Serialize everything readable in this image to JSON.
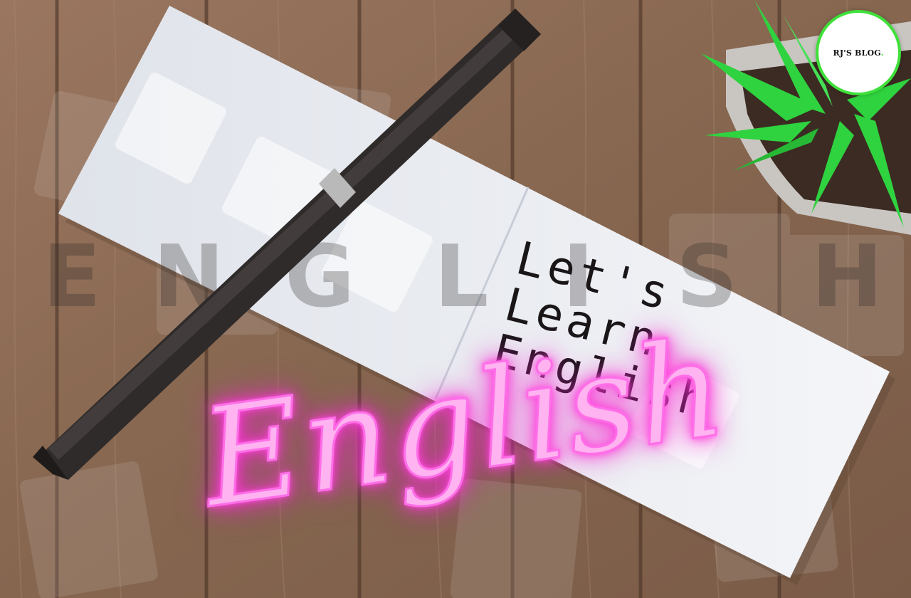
{
  "badge": {
    "text": "RJ'S BLOG",
    "dot": "."
  },
  "notebook": {
    "text": "Let's Learn\nEnglish"
  },
  "neon": {
    "text": "English",
    "color": "#ff5fe6"
  },
  "watermark_letters": [
    "E",
    "N",
    "G",
    "L",
    "I",
    "S",
    "H"
  ],
  "colors": {
    "wood": "#8a6a56",
    "paper": "#eef0f4",
    "pen": "#2f2b2a",
    "plant": "#2fd23f",
    "badge_ring": "#3fe03a"
  }
}
